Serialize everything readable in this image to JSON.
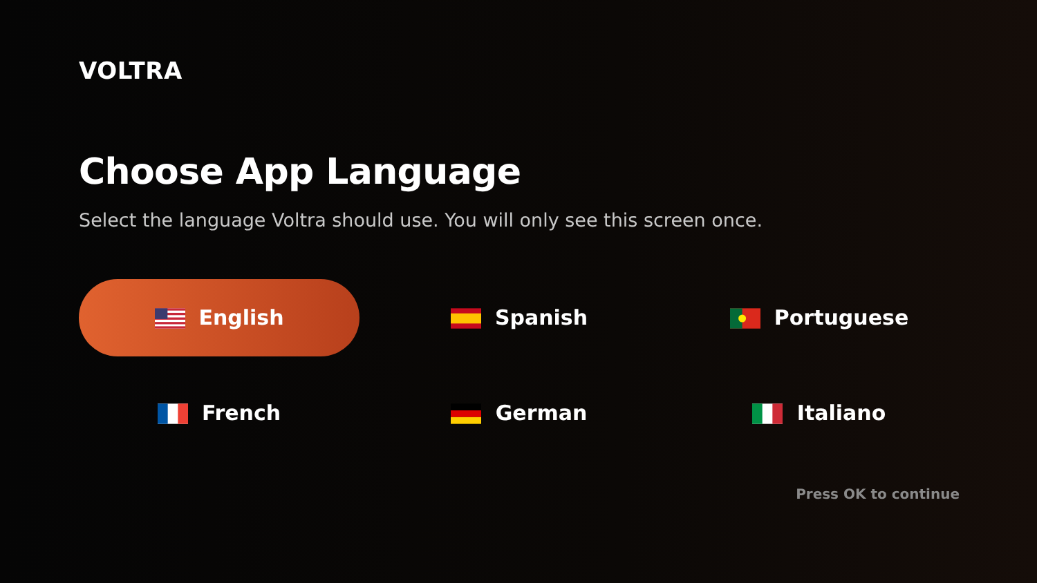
{
  "logo": "VOLTRA",
  "title": "Choose App Language",
  "subtitle": "Select the language Voltra should use. You will only see this screen once.",
  "languages": [
    {
      "label": "English",
      "kind": "us",
      "selected": true
    },
    {
      "label": "Spanish",
      "kind": "es",
      "selected": false
    },
    {
      "label": "Portuguese",
      "kind": "pt",
      "selected": false
    },
    {
      "label": "French",
      "kind": "fr",
      "selected": false
    },
    {
      "label": "German",
      "kind": "de",
      "selected": false
    },
    {
      "label": "Italiano",
      "kind": "it",
      "selected": false
    }
  ],
  "hint": "Press OK to continue"
}
